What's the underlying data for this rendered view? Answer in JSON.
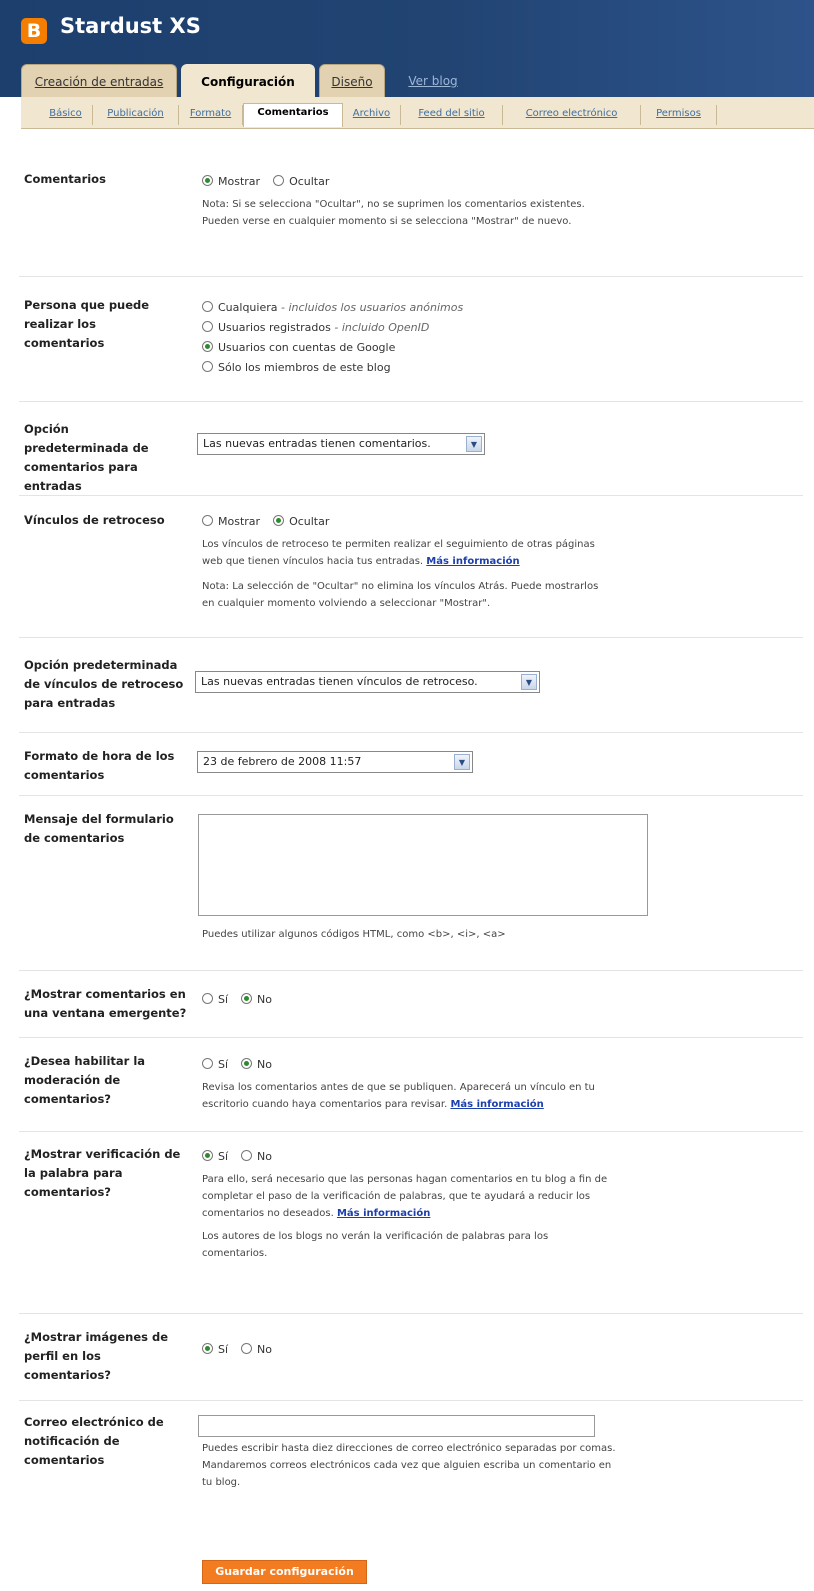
{
  "header": {
    "logo_letter": "B",
    "blog_title": "Stardust XS"
  },
  "tabs": [
    {
      "label": "Creación de entradas"
    },
    {
      "label": "Configuración"
    },
    {
      "label": "Diseño"
    },
    {
      "label": "Ver blog"
    }
  ],
  "subtabs": [
    {
      "label": "Básico"
    },
    {
      "label": "Publicación"
    },
    {
      "label": "Formato"
    },
    {
      "label": "Comentarios"
    },
    {
      "label": "Archivo"
    },
    {
      "label": "Feed del sitio"
    },
    {
      "label": "Correo electrónico"
    },
    {
      "label": "Permisos"
    }
  ],
  "comentarios": {
    "label": "Comentarios",
    "opt_show": "Mostrar",
    "opt_hide": "Ocultar",
    "selected": "Mostrar",
    "note": "Nota: Si se selecciona \"Ocultar\", no se suprimen los comentarios existentes. Pueden verse en cualquier momento si se selecciona \"Mostrar\" de nuevo."
  },
  "persona": {
    "label": "Persona que puede realizar los comentarios",
    "options": [
      {
        "text": "Cualquiera",
        "note": " - incluidos los usuarios anónimos"
      },
      {
        "text": "Usuarios registrados",
        "note": " - incluido OpenID"
      },
      {
        "text": "Usuarios con cuentas de Google",
        "note": ""
      },
      {
        "text": "Sólo los miembros de este blog",
        "note": ""
      }
    ],
    "selected_index": 2
  },
  "opcion_entradas": {
    "label": "Opción predeterminada de comentarios para entradas",
    "value": "Las nuevas entradas tienen comentarios."
  },
  "vinculos": {
    "label": "Vínculos de retroceso",
    "opt_show": "Mostrar",
    "opt_hide": "Ocultar",
    "selected": "Ocultar",
    "note1": "Los vínculos de retroceso te permiten realizar el seguimiento de otras páginas web que tienen vínculos hacia tus entradas.",
    "more_info": "Más información",
    "note2": "Nota: La selección de \"Ocultar\" no elimina los vínculos Atrás. Puede mostrarlos en cualquier momento volviendo a seleccionar \"Mostrar\"."
  },
  "opcion_vinculos": {
    "label": "Opción predeterminada de vínculos de retroceso para entradas",
    "value": "Las nuevas entradas tienen vínculos de retroceso."
  },
  "formato_hora": {
    "label": "Formato de hora de los comentarios",
    "value": "23 de febrero de 2008 11:57"
  },
  "mensaje": {
    "label": "Mensaje del formulario de comentarios",
    "value": "",
    "note": "Puedes utilizar algunos códigos HTML, como <b>, <i>, <a>"
  },
  "emergente": {
    "label": "¿Mostrar comentarios en una ventana emergente?",
    "opt_yes": "Sí",
    "opt_no": "No",
    "selected": "No"
  },
  "moderacion": {
    "label": "¿Desea habilitar la moderación de comentarios?",
    "opt_yes": "Sí",
    "opt_no": "No",
    "selected": "No",
    "note": "Revisa los comentarios antes de que se publiquen. Aparecerá un vínculo en tu escritorio cuando haya comentarios para revisar.",
    "more_info": "Más información"
  },
  "verificacion": {
    "label": "¿Mostrar verificación de la palabra para comentarios?",
    "opt_yes": "Sí",
    "opt_no": "No",
    "selected": "Sí",
    "note1": "Para ello, será necesario que las personas hagan comentarios en tu blog a fin de completar el paso de la verificación de palabras, que te ayudará a reducir los comentarios no deseados.",
    "more_info": "Más información",
    "note2": "Los autores de los blogs no verán la verificación de palabras para los comentarios."
  },
  "imagenes": {
    "label": "¿Mostrar imágenes de perfil en los comentarios?",
    "opt_yes": "Sí",
    "opt_no": "No",
    "selected": "Sí"
  },
  "correo": {
    "label": "Correo electrónico de notificación de comentarios",
    "value": "",
    "note": "Puedes escribir hasta diez direcciones de correo electrónico separadas por comas. Mandaremos correos electrónicos cada vez que alguien escriba un comentario en tu blog."
  },
  "save_button": "Guardar configuración",
  "colors": {
    "header_bg": "#1d3f6e",
    "tab_bg": "#e2d2b1",
    "active_tab_bg": "#f1e6cf",
    "link": "#1c3fae",
    "save_bg": "#f47c20"
  }
}
